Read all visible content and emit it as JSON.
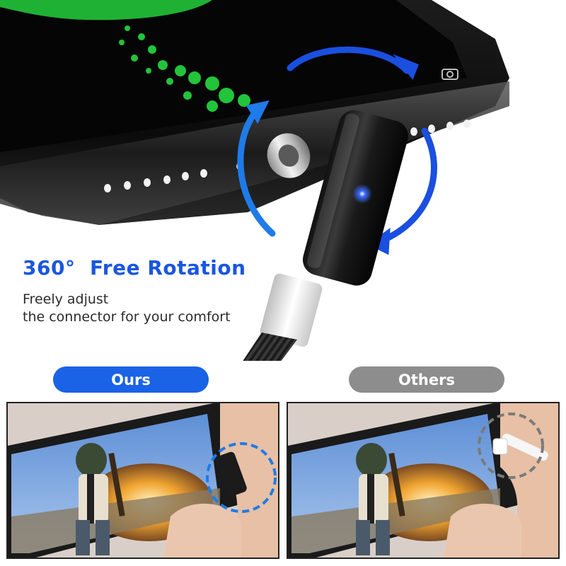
{
  "feature": {
    "headline": "360°  Free Rotation",
    "description_lines": [
      "Freely adjust",
      "the connector for your comfort"
    ]
  },
  "comparison": {
    "ours_label": "Ours",
    "others_label": "Others"
  },
  "colors": {
    "accent_blue": "#1a56e0",
    "pill_blue": "#1a62e6",
    "pill_gray": "#8d8d8d",
    "led_blue": "#3b6bff",
    "screen_green": "#22c43a"
  },
  "icons": [
    "rotation-arrow-icon",
    "camera-icon",
    "led-indicator-icon"
  ]
}
